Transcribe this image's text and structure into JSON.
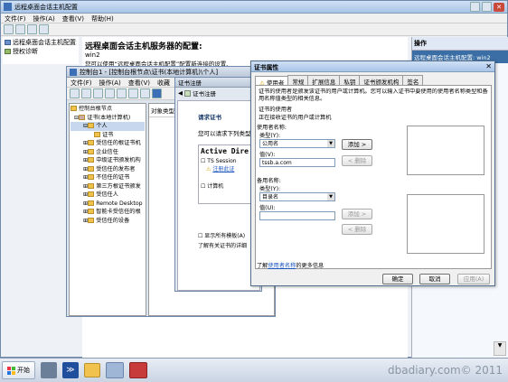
{
  "main": {
    "title": "远程桌面会话主机配置",
    "menu": [
      "文件(F)",
      "操作(A)",
      "查看(V)",
      "帮助(H)"
    ],
    "tree": [
      "远程桌面会话主机配置: win2",
      "授权诊断"
    ],
    "heading": "远程桌面会话主机服务器的配置:",
    "server": "win2",
    "desc": "您可以使用“远程桌面会话主机配置”配置新连接的设置、"
  },
  "actions": {
    "title": "操作",
    "item": "远程桌面会话主机配置: win2"
  },
  "mmc": {
    "title": "控制台1 - [控制台根节点\\证书(本地计算机)\\个人]",
    "menu": [
      "文件(F)",
      "操作(A)",
      "查看(V)",
      "收藏"
    ],
    "tree": [
      "控制台根节点",
      "证书(本地计算机)",
      "个人",
      "证书",
      "受信任的根证书机",
      "企业信任",
      "中级证书颁发机构",
      "受信任的发布者",
      "不信任的证书",
      "第三方根证书颁发",
      "受信任人",
      "Remote Desktop",
      "智能卡受信任的根",
      "受信任的设备"
    ],
    "col": "对象类型"
  },
  "enroll": {
    "title": "证书注册",
    "header": "证书注册",
    "heading": "请求证书",
    "desc": "您可以请求下列类型",
    "section": "Active Dire",
    "item1": "TS Session",
    "item1_link": "注册此证",
    "item2": "计算机",
    "show_all": "显示所有模板(A)",
    "learn": "了解有关证书的详细"
  },
  "props": {
    "title": "证书属性",
    "tabs": [
      "使用者",
      "常规",
      "扩展信息",
      "私钥",
      "证书颁发机构",
      "签名"
    ],
    "info": "证书的使用者是颁发该证书的用户或计算机。您可以输入证书中要使用的使用者名称类型和备用名称值类型的相关信息。",
    "subject_label": "证书的使用者",
    "subject_desc": "正在接收证书的用户或计算机",
    "subj_name": "使用者名称:",
    "type_label": "类型(Y):",
    "type_val": "公用名",
    "value_label": "值(V):",
    "value_val": "tssb.a.com",
    "alt_name": "备用名称:",
    "alt_type_label": "类型(Y):",
    "alt_type_val": "目录名",
    "alt_value_label": "值(U):",
    "add": "添加 >",
    "remove": "< 删除",
    "add2": "添加 >",
    "remove2": "< 删除",
    "learn_prefix": "了解",
    "learn_link": "使用者名称",
    "learn_suffix": "的更多信息",
    "ok": "确定",
    "cancel": "取消",
    "apply": "应用(A)"
  },
  "taskbar": {
    "start": "开始",
    "watermark": "dbadiary.com© 2011"
  }
}
